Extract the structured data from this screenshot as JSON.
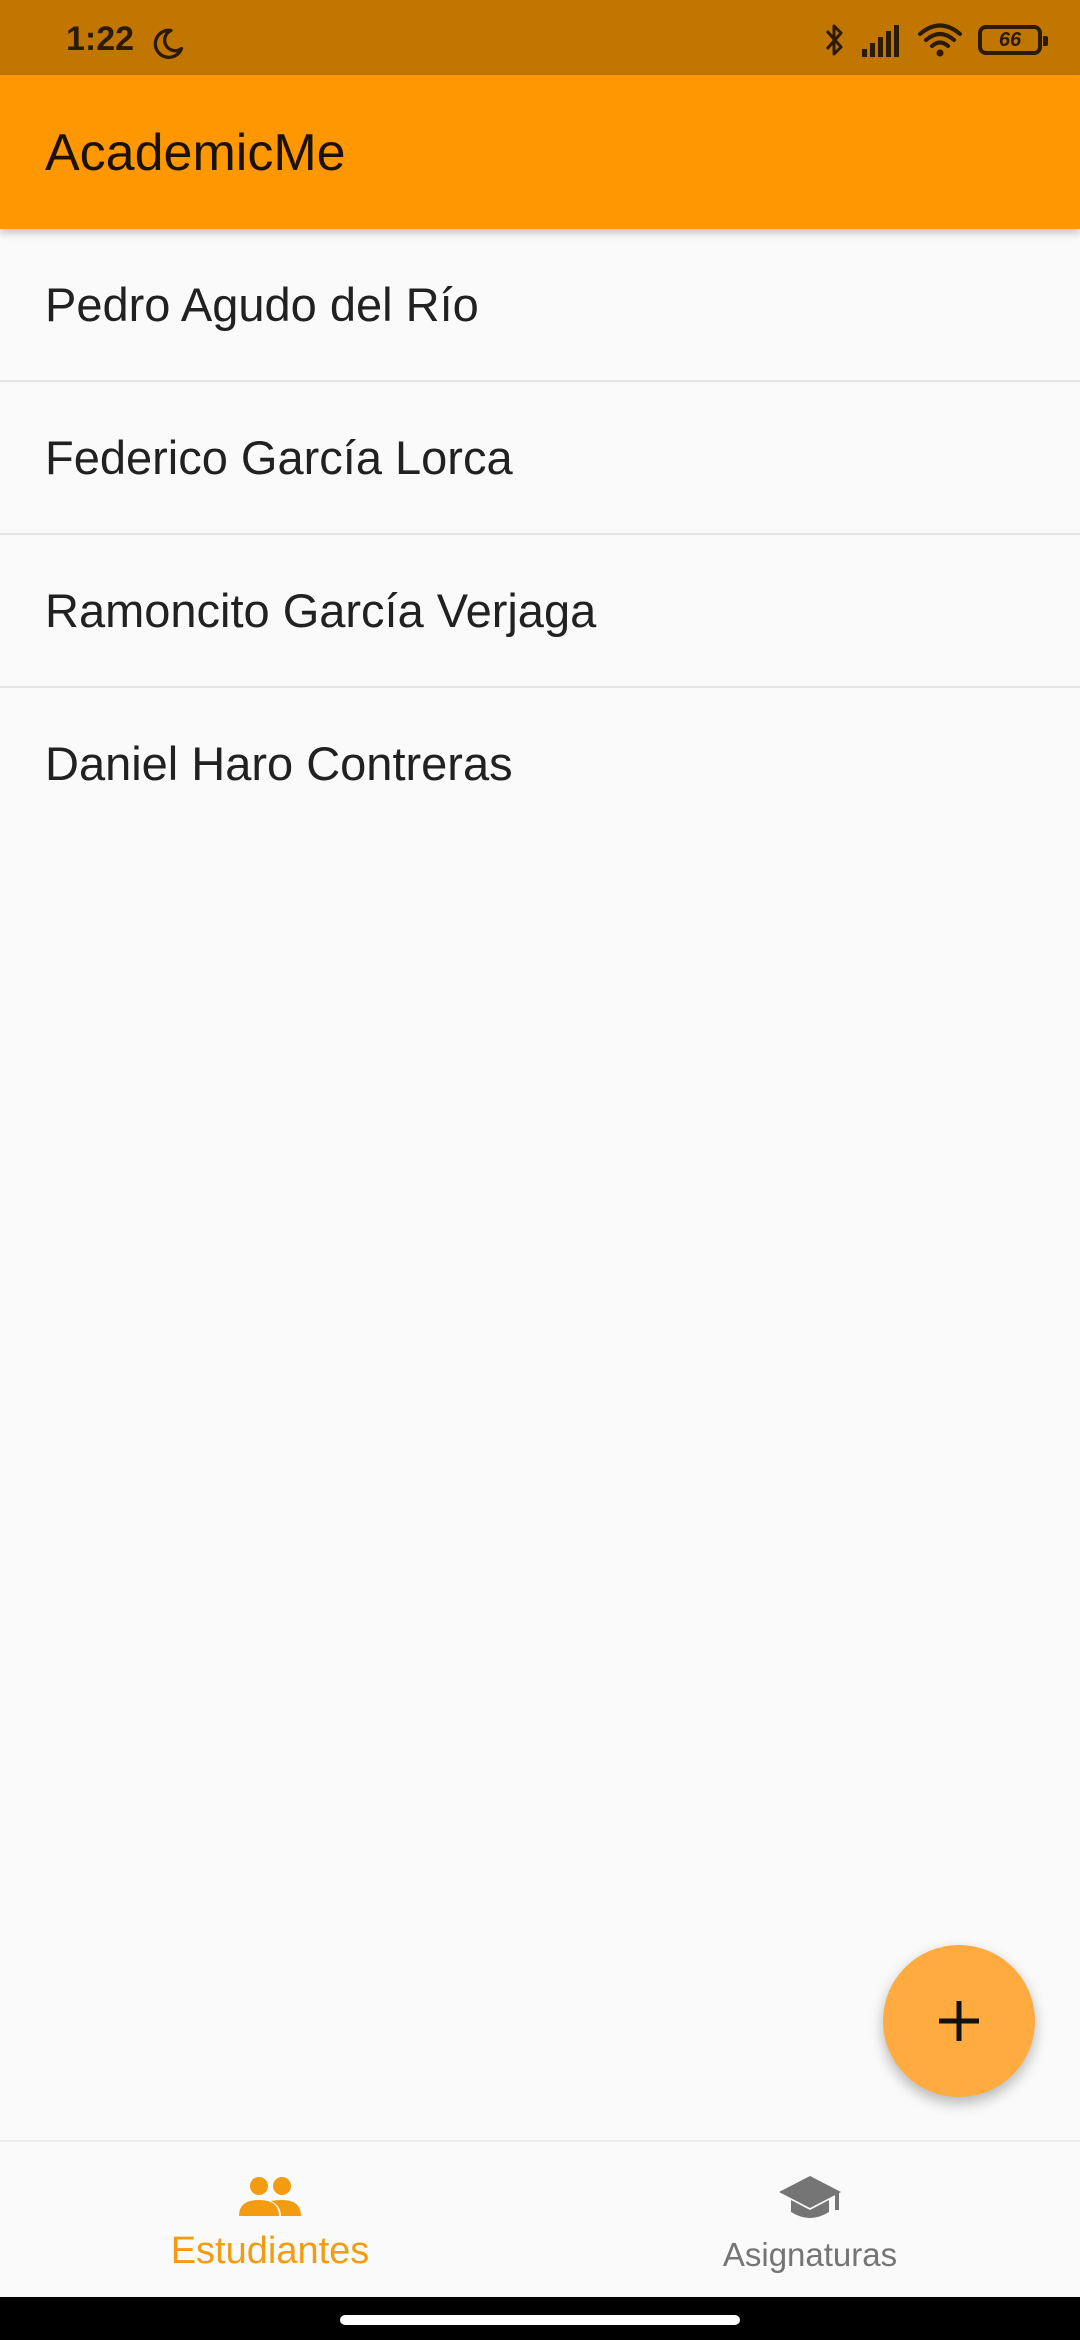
{
  "status_bar": {
    "time": "1:22",
    "battery_level": "66",
    "icons": [
      "moon-icon",
      "bluetooth-icon",
      "signal-icon",
      "wifi-icon",
      "battery-icon"
    ]
  },
  "app_bar": {
    "title": "AcademicMe",
    "color": "#ff9800"
  },
  "students": [
    {
      "name": "Pedro Agudo del Río"
    },
    {
      "name": "Federico García Lorca"
    },
    {
      "name": "Ramoncito García Verjaga"
    },
    {
      "name": "Daniel Haro Contreras"
    }
  ],
  "fab": {
    "icon": "plus-icon",
    "color": "#ffab40"
  },
  "bottom_nav": {
    "items": [
      {
        "label": "Estudiantes",
        "icon": "people-icon",
        "active": true
      },
      {
        "label": "Asignaturas",
        "icon": "school-icon",
        "active": false
      }
    ],
    "active_color": "#f39c12",
    "inactive_color": "#757575"
  }
}
